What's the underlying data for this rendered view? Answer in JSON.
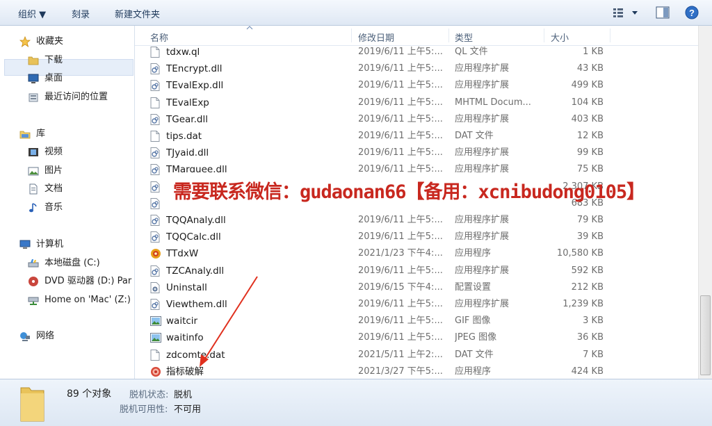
{
  "toolbar": {
    "organize_label": "组织 ▼",
    "burn_label": "刻录",
    "new_folder_label": "新建文件夹",
    "view_icon": "view-options-icon",
    "pane_icon": "preview-pane-icon",
    "help_icon": "help-icon"
  },
  "nav": {
    "favorites": {
      "label": "收藏夹",
      "items": [
        "下载",
        "桌面",
        "最近访问的位置"
      ]
    },
    "libraries": {
      "label": "库",
      "items": [
        "视频",
        "图片",
        "文档",
        "音乐"
      ]
    },
    "computer": {
      "label": "计算机",
      "items": [
        "本地磁盘 (C:)",
        "DVD 驱动器 (D:) Par",
        "Home on 'Mac' (Z:)"
      ]
    },
    "network": {
      "label": "网络"
    }
  },
  "columns": {
    "name": "名称",
    "date": "修改日期",
    "type": "类型",
    "size": "大小"
  },
  "files": [
    {
      "name": "tdxw.ql",
      "date": "2019/6/11 上午5:...",
      "type": "QL 文件",
      "size": "1 KB",
      "icon": "blank"
    },
    {
      "name": "TEncrypt.dll",
      "date": "2019/6/11 上午5:...",
      "type": "应用程序扩展",
      "size": "43 KB",
      "icon": "dll"
    },
    {
      "name": "TEvalExp.dll",
      "date": "2019/6/11 上午5:...",
      "type": "应用程序扩展",
      "size": "499 KB",
      "icon": "dll"
    },
    {
      "name": "TEvalExp",
      "date": "2019/6/11 上午5:...",
      "type": "MHTML Docum...",
      "size": "104 KB",
      "icon": "blank"
    },
    {
      "name": "TGear.dll",
      "date": "2019/6/11 上午5:...",
      "type": "应用程序扩展",
      "size": "403 KB",
      "icon": "dll"
    },
    {
      "name": "tips.dat",
      "date": "2019/6/11 上午5:...",
      "type": "DAT 文件",
      "size": "12 KB",
      "icon": "blank"
    },
    {
      "name": "TJyaid.dll",
      "date": "2019/6/11 上午5:...",
      "type": "应用程序扩展",
      "size": "99 KB",
      "icon": "dll"
    },
    {
      "name": "TMarquee.dll",
      "date": "2019/6/11 上午5:...",
      "type": "应用程序扩展",
      "size": "75 KB",
      "icon": "dll"
    },
    {
      "name": "",
      "date": "",
      "type": "",
      "size": "2,307 KB",
      "icon": "dll"
    },
    {
      "name": "",
      "date": "",
      "type": "",
      "size": "683 KB",
      "icon": "dll"
    },
    {
      "name": "TQQAnaly.dll",
      "date": "2019/6/11 上午5:...",
      "type": "应用程序扩展",
      "size": "79 KB",
      "icon": "dll"
    },
    {
      "name": "TQQCalc.dll",
      "date": "2019/6/11 上午5:...",
      "type": "应用程序扩展",
      "size": "39 KB",
      "icon": "dll"
    },
    {
      "name": "TTdxW",
      "date": "2021/1/23 下午4:...",
      "type": "应用程序",
      "size": "10,580 KB",
      "icon": "exe"
    },
    {
      "name": "TZCAnaly.dll",
      "date": "2019/6/11 上午5:...",
      "type": "应用程序扩展",
      "size": "592 KB",
      "icon": "dll"
    },
    {
      "name": "Uninstall",
      "date": "2019/6/15 下午4:...",
      "type": "配置设置",
      "size": "212 KB",
      "icon": "cfg"
    },
    {
      "name": "Viewthem.dll",
      "date": "2019/6/11 上午5:...",
      "type": "应用程序扩展",
      "size": "1,239 KB",
      "icon": "dll"
    },
    {
      "name": "waitcir",
      "date": "2019/6/11 上午5:...",
      "type": "GIF 图像",
      "size": "3 KB",
      "icon": "img"
    },
    {
      "name": "waitinfo",
      "date": "2019/6/11 上午5:...",
      "type": "JPEG 图像",
      "size": "36 KB",
      "icon": "img"
    },
    {
      "name": "zdcomte.dat",
      "date": "2021/5/11 上午2:...",
      "type": "DAT 文件",
      "size": "7 KB",
      "icon": "blank"
    },
    {
      "name": "指标破解",
      "date": "2021/3/27 下午5:...",
      "type": "应用程序",
      "size": "424 KB",
      "icon": "exe2"
    }
  ],
  "details": {
    "count_label": "89 个对象",
    "offline_status_label": "脱机状态:",
    "offline_status_value": "脱机",
    "offline_avail_label": "脱机可用性:",
    "offline_avail_value": "不可用"
  },
  "overlay_banner": "需要联系微信：gudaonan66【备用：xcnibudong0105】",
  "colors": {
    "accent": "#1e395b",
    "banner_text": "#c8281f",
    "arrow": "#e0301e"
  }
}
